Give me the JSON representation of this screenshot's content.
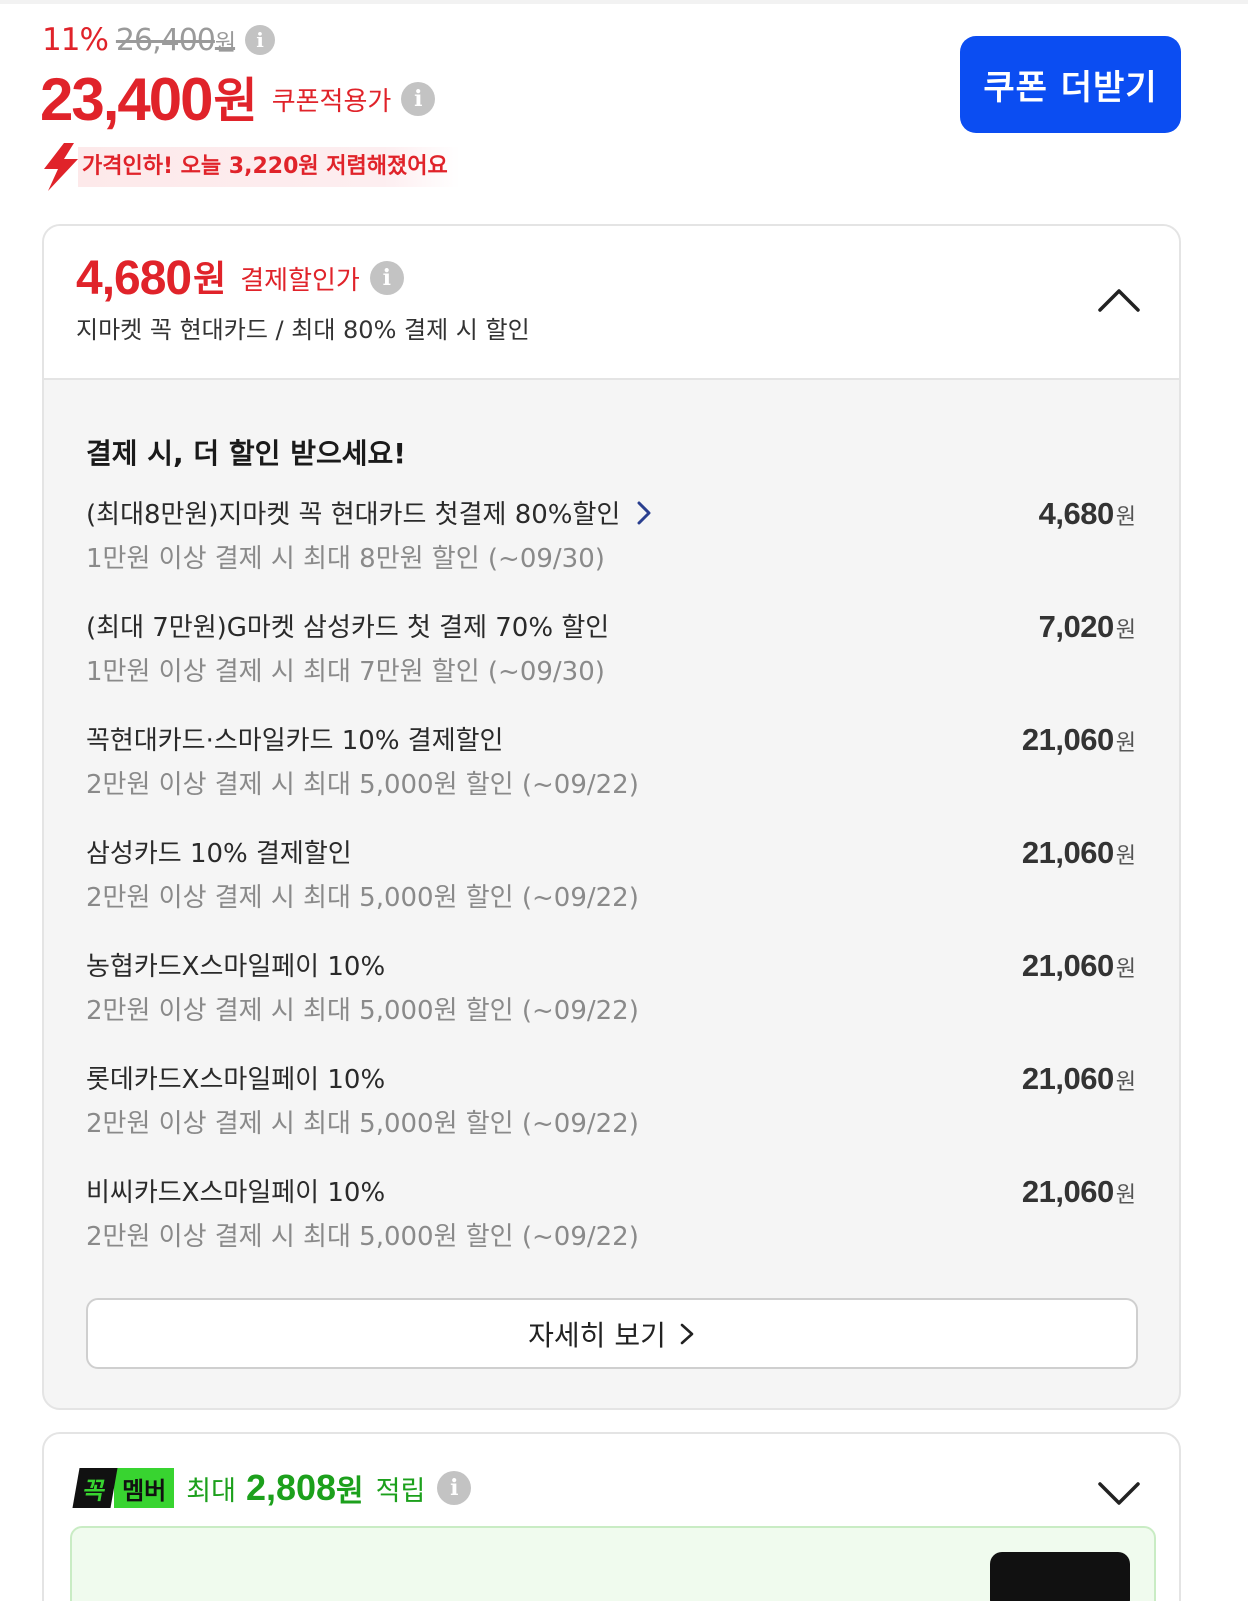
{
  "price": {
    "discount_rate": "11%",
    "original_price": "26,400",
    "original_currency": "원",
    "final_price": "23,400",
    "final_currency": "원",
    "final_label": "쿠폰적용가",
    "price_drop_text": "가격인하! 오늘 3,220원 저렴해졌어요",
    "info_glyph": "i"
  },
  "coupon_button": {
    "label": "쿠폰 더받기",
    "color": "#0b4df2"
  },
  "card_panel": {
    "head_price": "4,680",
    "head_currency": "원",
    "head_label": "결제할인가",
    "head_sub": "지마켓 꼭 현대카드 / 최대 80% 결제 시 할인",
    "section_title": "결제 시, 더 할인 받으세요!",
    "offers": [
      {
        "name": "(최대8만원)지마켓 꼭 현대카드 첫결제 80%할인",
        "desc": "1만원 이상 결제 시 최대 8만원 할인 (~09/30)",
        "price": "4,680",
        "currency": "원",
        "has_link": true
      },
      {
        "name": "(최대 7만원)G마켓 삼성카드 첫 결제 70% 할인",
        "desc": "1만원 이상 결제 시 최대 7만원 할인 (~09/30)",
        "price": "7,020",
        "currency": "원",
        "has_link": false
      },
      {
        "name": "꼭현대카드·스마일카드 10% 결제할인",
        "desc": "2만원 이상 결제 시 최대 5,000원 할인 (~09/22)",
        "price": "21,060",
        "currency": "원",
        "has_link": false
      },
      {
        "name": "삼성카드 10% 결제할인",
        "desc": "2만원 이상 결제 시 최대 5,000원 할인 (~09/22)",
        "price": "21,060",
        "currency": "원",
        "has_link": false
      },
      {
        "name": "농협카드X스마일페이 10%",
        "desc": "2만원 이상 결제 시 최대 5,000원 할인 (~09/22)",
        "price": "21,060",
        "currency": "원",
        "has_link": false
      },
      {
        "name": "롯데카드X스마일페이 10%",
        "desc": "2만원 이상 결제 시 최대 5,000원 할인 (~09/22)",
        "price": "21,060",
        "currency": "원",
        "has_link": false
      },
      {
        "name": "비씨카드X스마일페이 10%",
        "desc": "2만원 이상 결제 시 최대 5,000원 할인 (~09/22)",
        "price": "21,060",
        "currency": "원",
        "has_link": false
      }
    ],
    "detail_button": "자세히 보기"
  },
  "member_panel": {
    "badge_part1": "꼭",
    "badge_part2": "멤버",
    "prefix": "최대",
    "amount": "2,808",
    "currency": "원",
    "suffix": "적립",
    "accent_color": "#1ca01c"
  },
  "colors": {
    "sale_red": "#e0232a",
    "member_green": "#38d430"
  }
}
